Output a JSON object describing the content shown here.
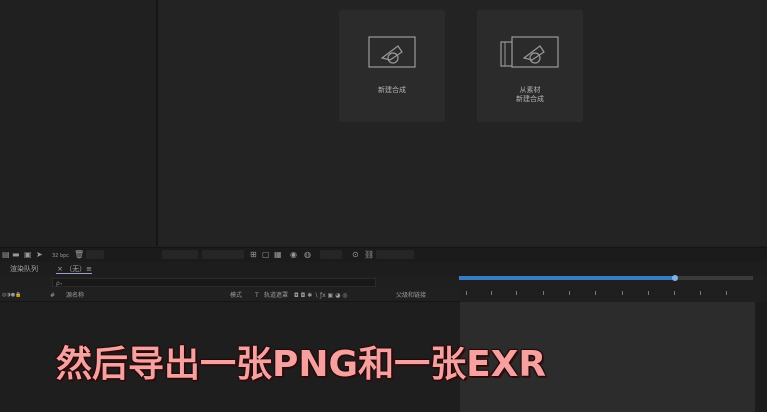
{
  "composition_panel": {
    "new_comp_label": "新建合成",
    "from_footage_label": "从素材\n新建合成"
  },
  "project_toolbar": {
    "bpc_label": "32 bpc"
  },
  "tabs": {
    "render_queue": "渲染队列",
    "composition": "×  （无）≡"
  },
  "search": {
    "placeholder": "ρ₊"
  },
  "layer_columns": {
    "switches": "◎◑●🔒",
    "label": "#",
    "source_name": "源名称",
    "mode": "模式",
    "t": "T",
    "trkmat": "轨道遮罩",
    "parent": "父级和链接"
  },
  "subtitle": "然后导出一张PNG和一张EXR",
  "colors": {
    "work_area": "#3a7cc4",
    "subtitle": "#f6a0a0"
  }
}
